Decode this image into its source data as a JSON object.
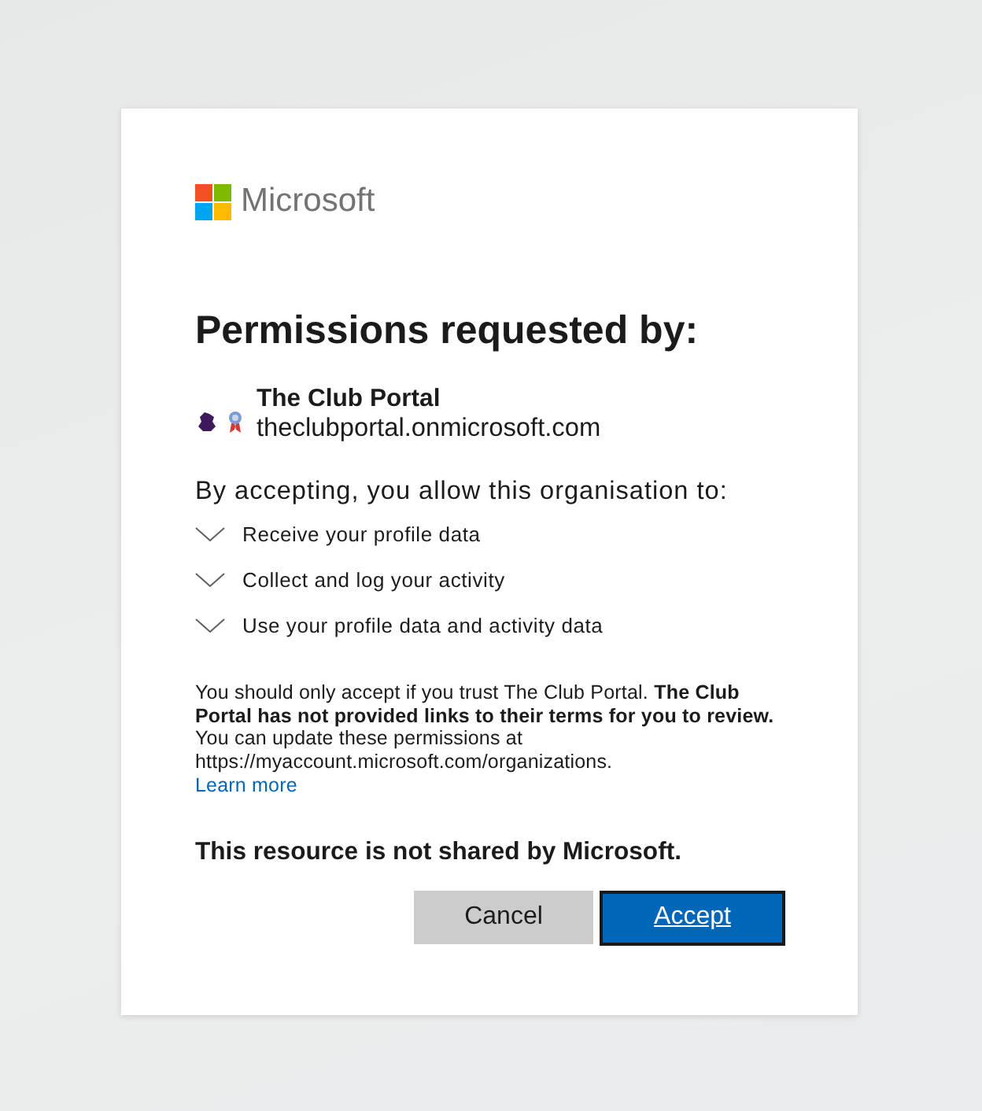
{
  "brand": {
    "name": "Microsoft"
  },
  "title": "Permissions requested by:",
  "app": {
    "name": "The Club Portal",
    "domain": "theclubportal.onmicrosoft.com"
  },
  "consent_intro": "By accepting, you allow this organisation to:",
  "permissions": [
    {
      "label": "Receive your profile data"
    },
    {
      "label": "Collect and log your activity"
    },
    {
      "label": "Use your profile data and activity data"
    }
  ],
  "notice": "You should only accept if you trust The Club Portal. **The Club Portal has not provided links to their terms for you to review.** You can update these permissions at https://myaccount.microsoft.com/organizations.",
  "learn_more": "Learn more",
  "disclaimer": "This resource is not shared by Microsoft.",
  "buttons": [
    {
      "label": "Cancel",
      "kind": "secondary",
      "focused": false
    },
    {
      "label": "Accept",
      "kind": "primary",
      "focused": true
    }
  ]
}
